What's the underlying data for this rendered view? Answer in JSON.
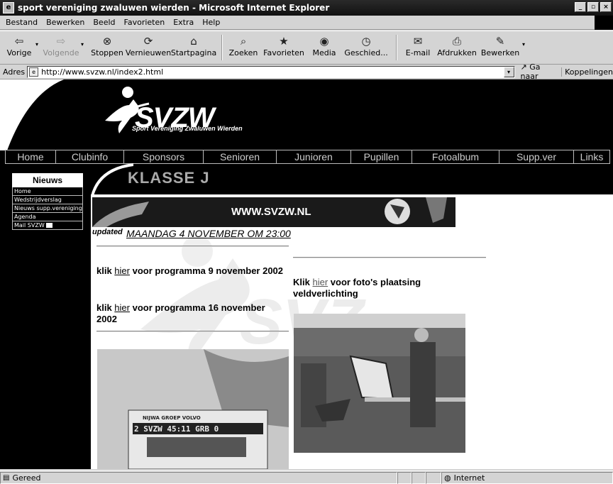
{
  "window": {
    "title": "sport vereniging zwaluwen wierden - Microsoft Internet Explorer"
  },
  "menu": [
    "Bestand",
    "Bewerken",
    "Beeld",
    "Favorieten",
    "Extra",
    "Help"
  ],
  "toolbar": {
    "back": "Vorige",
    "forward": "Volgende",
    "stop": "Stoppen",
    "refresh": "Vernieuwen",
    "home": "Startpagina",
    "search": "Zoeken",
    "favorites": "Favorieten",
    "media": "Media",
    "history": "Geschied...",
    "mail": "E-mail",
    "print": "Afdrukken",
    "edit": "Bewerken"
  },
  "address": {
    "label": "Adres",
    "url": "http://www.svzw.nl/index2.html",
    "go": "Ga naar",
    "links": "Koppelingen"
  },
  "site": {
    "logo": "SVZW",
    "logo_subtitle": "Sport Vereniging Zwaluwen Wierden",
    "nav": [
      "Home",
      "Clubinfo",
      "Sponsors",
      "Senioren",
      "Junioren",
      "Pupillen",
      "Fotoalbum",
      "Supp.ver",
      "Links"
    ],
    "sidebar_title": "Nieuws",
    "sidebar_items": [
      "Home",
      "Wedstrijdverslag",
      "Nieuws supp.vereniging",
      "Agenda",
      "Mail SVZW"
    ],
    "page_heading": "KLASSE J",
    "banner": "WWW.SVZW.NL",
    "updated_badge": "updated",
    "updated_date": "MAANDAG 4 NOVEMBER OM 23:00",
    "prog1_pre": "klik ",
    "prog1_link": "hier",
    "prog1_post": "  voor programma 9 november 2002",
    "prog2_pre": "klik ",
    "prog2_link": "hier",
    "prog2_post": "  voor programma 16 november 2002",
    "foto_pre": "Klik ",
    "foto_link": "hier",
    "foto_post": " voor foto's plaatsing veldverlichting",
    "scoreboard": "2 SVZW   45:11   GRB 0",
    "scoreboard_sponsor": "NIJWA GROEP  VOLVO"
  },
  "status": {
    "text": "Gereed",
    "zone": "Internet"
  }
}
